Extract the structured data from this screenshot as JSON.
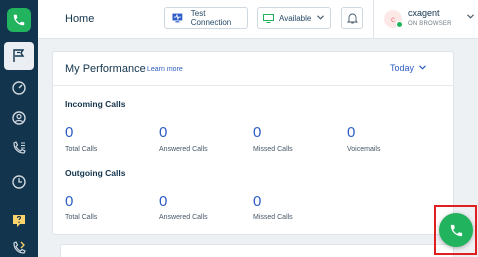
{
  "header": {
    "page_title": "Home",
    "test_connection_label": "Test Connection",
    "status_value": "Available",
    "agent_initial": "c",
    "agent_name": "cxagent",
    "agent_subtitle": "ON BROWSER"
  },
  "sidebar": {
    "items": [
      {
        "icon": "flag-icon",
        "active": true
      },
      {
        "icon": "dashboard-gauge-icon"
      },
      {
        "icon": "contacts-icon"
      },
      {
        "icon": "call-logs-icon"
      },
      {
        "icon": "history-icon"
      },
      {
        "icon": "help-icon"
      },
      {
        "icon": "call-transfer-icon"
      }
    ]
  },
  "performance": {
    "title": "My Performance",
    "learn_more": "Learn more",
    "period": "Today",
    "incoming": {
      "title": "Incoming Calls",
      "metrics": [
        {
          "value": "0",
          "label": "Total Calls"
        },
        {
          "value": "0",
          "label": "Answered Calls"
        },
        {
          "value": "0",
          "label": "Missed Calls"
        },
        {
          "value": "0",
          "label": "Voicemails"
        }
      ]
    },
    "outgoing": {
      "title": "Outgoing Calls",
      "metrics": [
        {
          "value": "0",
          "label": "Total Calls"
        },
        {
          "value": "0",
          "label": "Answered Calls"
        },
        {
          "value": "0",
          "label": "Missed Calls"
        }
      ]
    }
  },
  "colors": {
    "sidebar_bg": "#12344d",
    "accent_green": "#21b35d",
    "link_blue": "#2c5cc5",
    "highlight_red": "#e02020"
  }
}
